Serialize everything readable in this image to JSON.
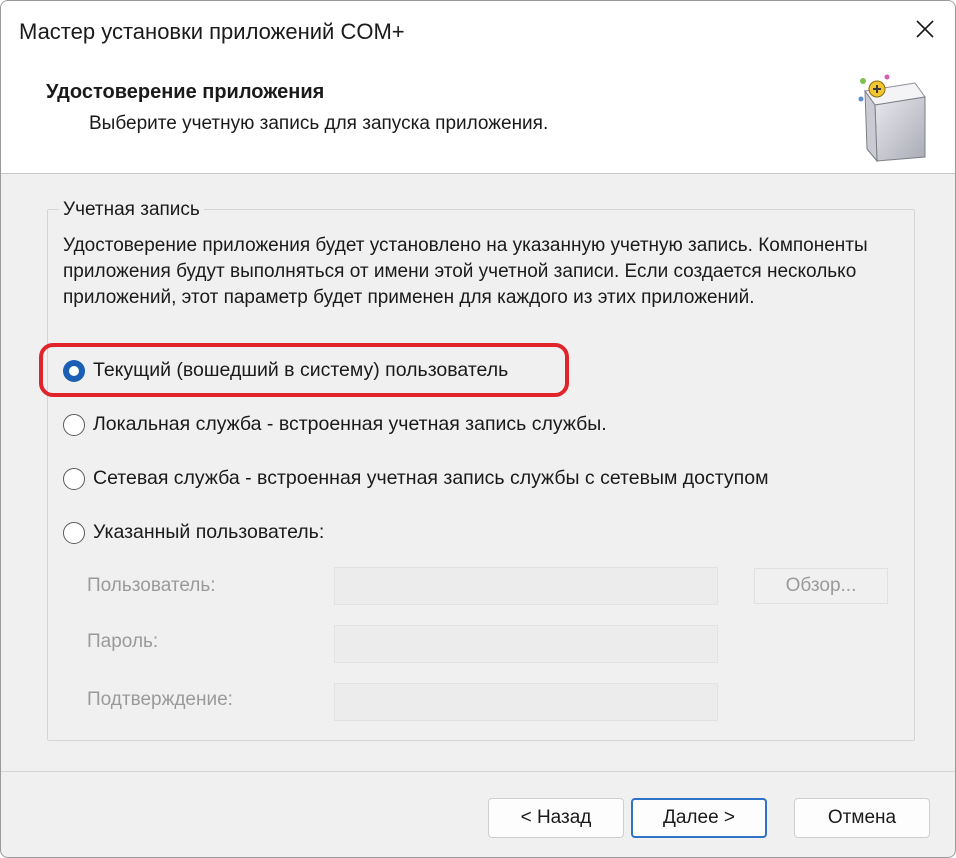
{
  "window": {
    "title": "Мастер установки приложений COM+"
  },
  "header": {
    "title": "Удостоверение приложения",
    "subtitle": "Выберите учетную запись для запуска приложения."
  },
  "account_group": {
    "legend": "Учетная запись",
    "description": "Удостоверение приложения будет установлено на указанную учетную запись. Компоненты приложения будут выполняться от имени этой учетной записи.  Если создается несколько приложений, этот параметр будет применен для каждого из этих приложений.",
    "options": [
      {
        "label": "Текущий (вошедший в систему) пользователь",
        "checked": true
      },
      {
        "label": "Локальная служба - встроенная учетная запись службы.",
        "checked": false
      },
      {
        "label": "Сетевая служба - встроенная учетная запись службы с сетевым доступом",
        "checked": false
      },
      {
        "label": "Указанный пользователь:",
        "checked": false
      }
    ],
    "fields": {
      "user_label": "Пользователь:",
      "user_value": "",
      "password_label": "Пароль:",
      "password_value": "",
      "confirm_label": "Подтверждение:",
      "confirm_value": "",
      "browse_label": "Обзор..."
    }
  },
  "buttons": {
    "back": "< Назад",
    "next": "Далее >",
    "cancel": "Отмена"
  },
  "colors": {
    "accent": "#1a5fb4",
    "highlight": "#e0242a",
    "disabled_text": "#9a9a9a"
  }
}
